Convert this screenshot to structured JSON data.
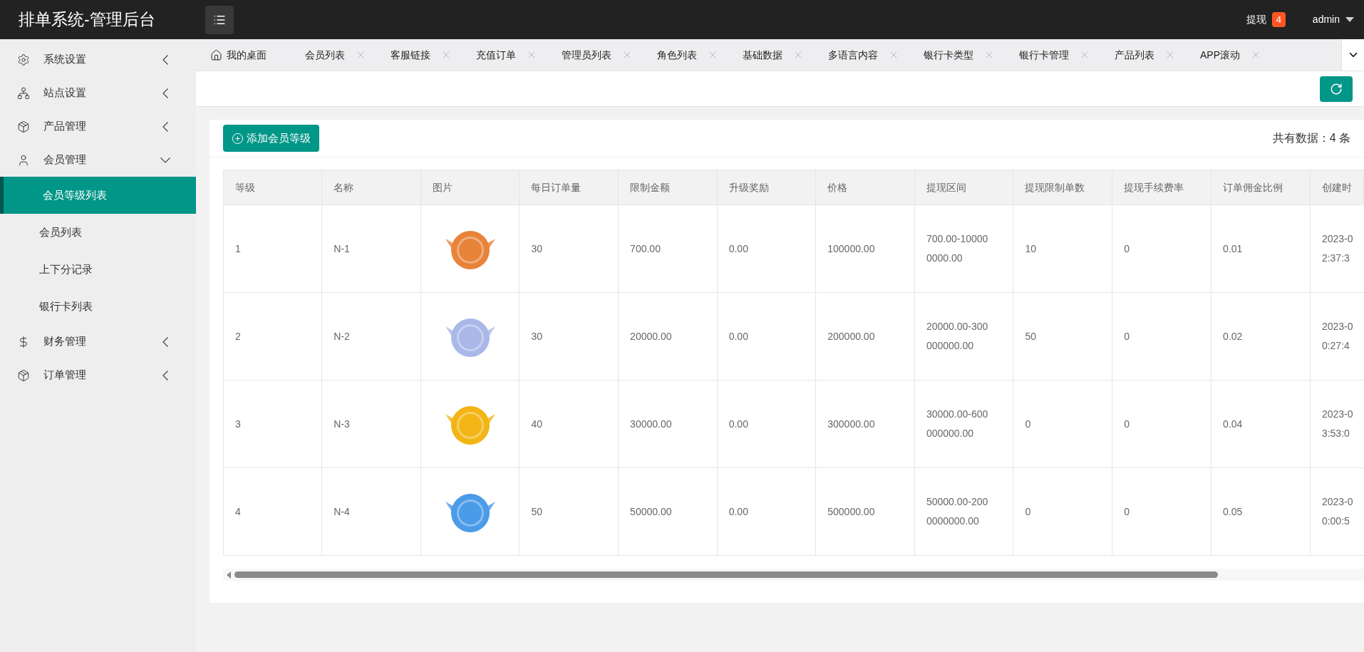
{
  "header": {
    "title": "排单系统-管理后台",
    "withdraw_label": "提现",
    "withdraw_count": "4",
    "user": "admin"
  },
  "sidebar": {
    "items": [
      {
        "kind": "gear",
        "label": "系统设置",
        "expanded": false
      },
      {
        "kind": "network",
        "label": "站点设置",
        "expanded": false
      },
      {
        "kind": "box",
        "label": "产品管理",
        "expanded": false
      },
      {
        "kind": "user",
        "label": "会员管理",
        "expanded": true,
        "children": [
          {
            "label": "会员等级列表",
            "selected": true
          },
          {
            "label": "会员列表",
            "selected": false
          },
          {
            "label": "上下分记录",
            "selected": false
          },
          {
            "label": "银行卡列表",
            "selected": false
          }
        ]
      },
      {
        "kind": "dollar",
        "label": "财务管理",
        "expanded": false
      },
      {
        "kind": "box",
        "label": "订单管理",
        "expanded": false
      }
    ]
  },
  "tabs": [
    {
      "kind": "home",
      "label": "我的桌面"
    },
    {
      "kind": "closable",
      "label": "会员列表"
    },
    {
      "kind": "closable",
      "label": "客服链接"
    },
    {
      "kind": "closable",
      "label": "充值订单"
    },
    {
      "kind": "closable",
      "label": "管理员列表"
    },
    {
      "kind": "closable",
      "label": "角色列表"
    },
    {
      "kind": "closable",
      "label": "基础数据"
    },
    {
      "kind": "closable",
      "label": "多语言内容"
    },
    {
      "kind": "closable",
      "label": "银行卡类型"
    },
    {
      "kind": "closable",
      "label": "银行卡管理"
    },
    {
      "kind": "closable",
      "label": "产品列表"
    },
    {
      "kind": "closable",
      "label": "APP滚动"
    }
  ],
  "toolbar": {
    "add_button": "添加会员等级",
    "total": "共有数据：4 条"
  },
  "table": {
    "columns": [
      "等级",
      "名称",
      "图片",
      "每日订单量",
      "限制金额",
      "升级奖励",
      "价格",
      "提现区间",
      "提现限制单数",
      "提现手续费率",
      "订单佣金比例",
      "创建时"
    ],
    "rows": [
      {
        "level": "1",
        "name": "N-1",
        "color": "#e8833a",
        "daily_orders": "30",
        "limit": "700.00",
        "reward": "0.00",
        "price": "100000.00",
        "range": "700.00-100000000.00",
        "withdraw_limit": "10",
        "fee_rate": "0",
        "commission": "0.01",
        "created": [
          "2023-0",
          "2:37:3"
        ]
      },
      {
        "level": "2",
        "name": "N-2",
        "color": "#a9b8e8",
        "daily_orders": "30",
        "limit": "20000.00",
        "reward": "0.00",
        "price": "200000.00",
        "range": "20000.00-300000000.00",
        "withdraw_limit": "50",
        "fee_rate": "0",
        "commission": "0.02",
        "created": [
          "2023-0",
          "0:27:4"
        ]
      },
      {
        "level": "3",
        "name": "N-3",
        "color": "#f2b515",
        "daily_orders": "40",
        "limit": "30000.00",
        "reward": "0.00",
        "price": "300000.00",
        "range": "30000.00-600000000.00",
        "withdraw_limit": "0",
        "fee_rate": "0",
        "commission": "0.04",
        "created": [
          "2023-0",
          "3:53:0"
        ]
      },
      {
        "level": "4",
        "name": "N-4",
        "color": "#4a9be8",
        "daily_orders": "50",
        "limit": "50000.00",
        "reward": "0.00",
        "price": "500000.00",
        "range": "50000.00-2000000000.00",
        "withdraw_limit": "0",
        "fee_rate": "0",
        "commission": "0.05",
        "created": [
          "2023-0",
          "0:00:5"
        ]
      }
    ]
  }
}
